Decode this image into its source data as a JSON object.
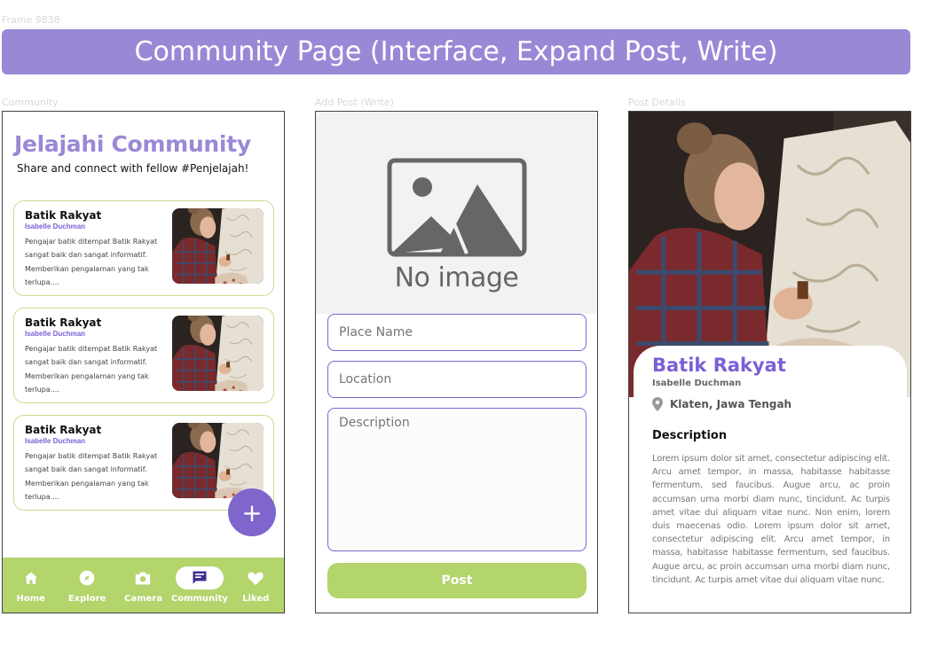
{
  "frame_label": "Frame 9838",
  "banner_title": "Community Page (Interface, Expand Post, Write)",
  "screen_labels": {
    "community": "Community",
    "add_post": "Add Post (Write)",
    "post_details": "Post Details"
  },
  "community": {
    "title": "Jelajahi Community",
    "subtitle": "Share and connect with fellow #Penjelajah!",
    "posts": [
      {
        "title": "Batik Rakyat",
        "author": "Isabelle Duchman",
        "excerpt": "Pengajar batik ditempat Batik Rakyat sangat baik dan sangat informatif. Memberikan pengalaman yang tak terlupa...."
      },
      {
        "title": "Batik Rakyat",
        "author": "Isabelle Duchman",
        "excerpt": "Pengajar batik ditempat Batik Rakyat sangat baik dan sangat informatif. Memberikan pengalaman yang tak terlupa...."
      },
      {
        "title": "Batik Rakyat",
        "author": "Isabelle Duchman",
        "excerpt": "Pengajar batik ditempat Batik Rakyat sangat baik dan sangat informatif. Memberikan pengalaman yang tak terlupa...."
      }
    ],
    "fab_label": "+",
    "nav": [
      {
        "label": "Home",
        "icon": "home-icon"
      },
      {
        "label": "Explore",
        "icon": "compass-icon"
      },
      {
        "label": "Camera",
        "icon": "camera-icon"
      },
      {
        "label": "Community",
        "icon": "chat-icon",
        "active": true
      },
      {
        "label": "Liked",
        "icon": "heart-icon"
      }
    ]
  },
  "add_post": {
    "no_image_text": "No image",
    "place_name_placeholder": "Place Name",
    "location_placeholder": "Location",
    "description_placeholder": "Description",
    "post_button": "Post"
  },
  "post_details": {
    "title": "Batik Rakyat",
    "author": "Isabelle Duchman",
    "location": "Klaten, Jawa Tengah",
    "description_heading": "Description",
    "description": "Lorem ipsum dolor sit amet, consectetur adipiscing elit. Arcu amet tempor, in massa, habitasse habitasse fermentum, sed faucibus. Augue arcu, ac proin accumsan urna morbi diam nunc, tincidunt. Ac turpis amet vitae dui aliquam vitae nunc. Non enim, lorem duis maecenas odio. Lorem ipsum dolor sit amet, consectetur adipiscing elit. Arcu amet tempor, in massa, habitasse habitasse fermentum, sed faucibus. Augue arcu, ac proin accumsan urna morbi diam nunc, tincidunt. Ac turpis amet vitae dui aliquam vitae nunc."
  },
  "colors": {
    "primary_purple": "#9a88d6",
    "accent_purple": "#7e66cc",
    "green": "#b4d46c",
    "card_border": "#c9dc8f"
  }
}
